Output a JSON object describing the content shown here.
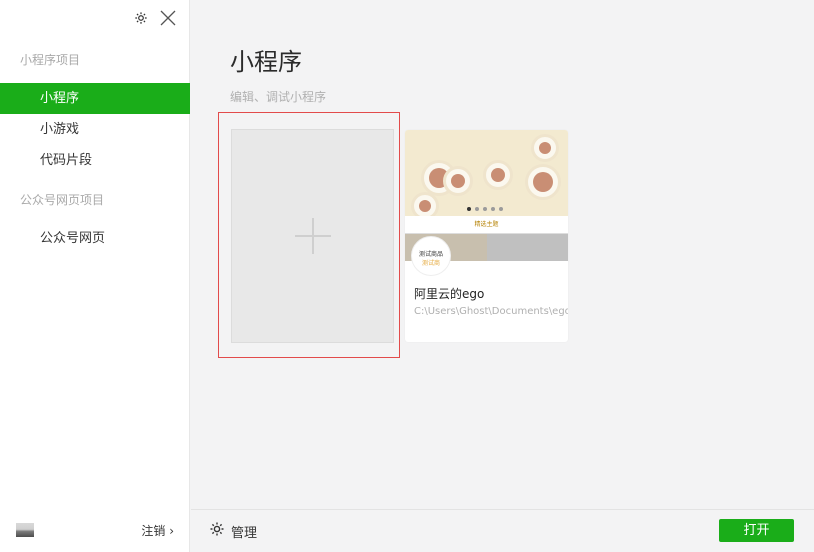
{
  "sidebar": {
    "section_miniprogram": "小程序项目",
    "items": [
      {
        "label": "小程序"
      },
      {
        "label": "小游戏"
      },
      {
        "label": "代码片段"
      }
    ],
    "section_official": "公众号网页项目",
    "official_items": [
      {
        "label": "公众号网页"
      }
    ],
    "logout_label": "注销 ›"
  },
  "main": {
    "title": "小程序",
    "subtitle": "编辑、调试小程序",
    "project": {
      "thumb_tab": "精选主题",
      "badge_line1": "测试商品",
      "badge_line2": "测试商",
      "name": "阿里云的ego",
      "path": "C:\\Users\\Ghost\\Documents\\ego"
    }
  },
  "footer": {
    "manage_label": "管理",
    "open_label": "打开"
  },
  "colors": {
    "accent": "#1aad19",
    "selection_border": "#e24b4b"
  },
  "icons": [
    "gear-icon",
    "close-icon",
    "plus-icon",
    "settings-icon"
  ]
}
